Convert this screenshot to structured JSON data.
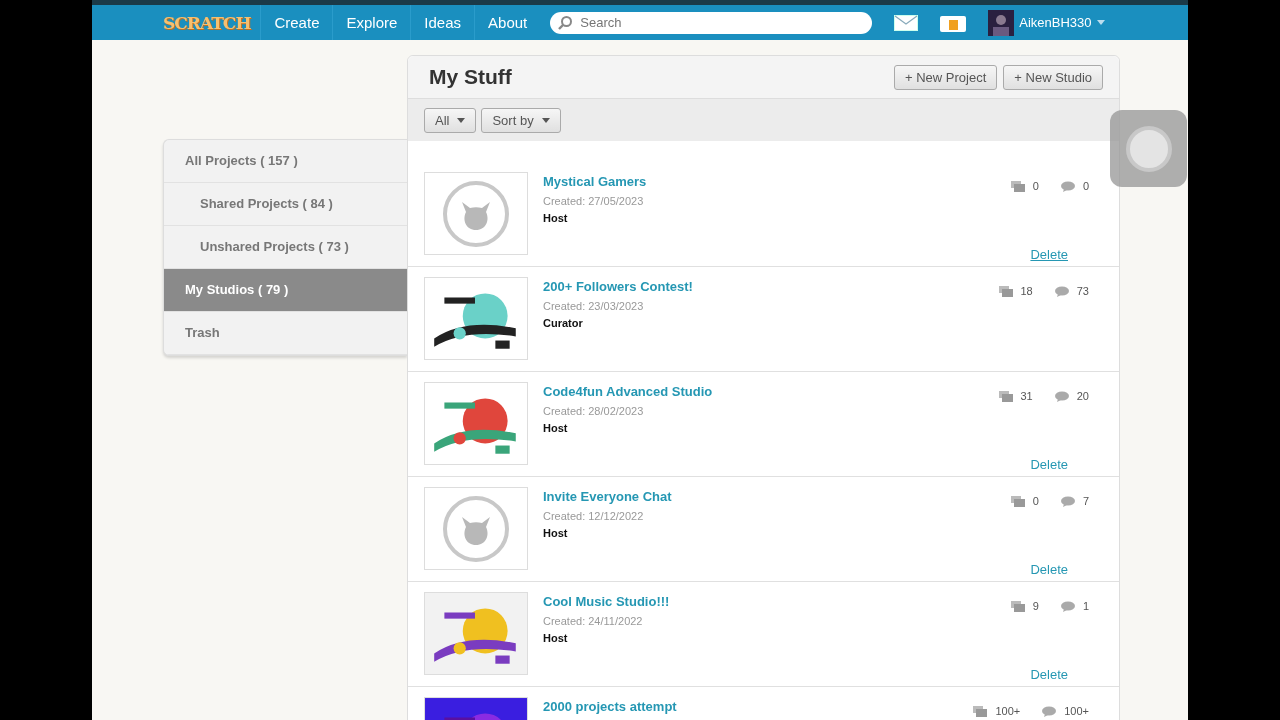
{
  "nav": {
    "logo": "SCRATCH",
    "links": [
      "Create",
      "Explore",
      "Ideas",
      "About"
    ],
    "search": {
      "placeholder": "Search"
    },
    "username": "AikenBH330"
  },
  "sidebar": {
    "items": [
      {
        "label": "All Projects ( 157 )",
        "selected": false,
        "children": [
          {
            "label": "Shared Projects ( 84 )",
            "selected": false
          },
          {
            "label": "Unshared Projects ( 73 )",
            "selected": false
          }
        ]
      },
      {
        "label": "My Studios ( 79 )",
        "selected": true
      },
      {
        "label": "Trash",
        "selected": false
      }
    ]
  },
  "panel": {
    "title": "My Stuff",
    "buttons": [
      "+ New Project",
      "+ New Studio"
    ],
    "filters": [
      "All",
      "Sort by"
    ],
    "rows": [
      {
        "title": "Mystical Gamers",
        "created": "Created: 27/05/2023",
        "role": "Host",
        "projects": "0",
        "comments": "0",
        "kind": "placeholder",
        "delete": "Delete",
        "hovered": true
      },
      {
        "title": "200+ Followers Contest!",
        "created": "Created: 23/03/2023",
        "role": "Curator",
        "projects": "18",
        "comments": "73",
        "kind": "picture"
      },
      {
        "title": "Code4fun Advanced Studio",
        "created": "Created: 28/02/2023",
        "role": "Host",
        "projects": "31",
        "comments": "20",
        "kind": "picture",
        "delete": "Delete",
        "hovered": false
      },
      {
        "title": "Invite Everyone Chat",
        "created": "Created: 12/12/2022",
        "role": "Host",
        "projects": "0",
        "comments": "7",
        "kind": "placeholder",
        "delete": "Delete",
        "hovered": false
      },
      {
        "title": "Cool Music Studio!!!",
        "created": "Created: 24/11/2022",
        "role": "Host",
        "projects": "9",
        "comments": "1",
        "kind": "picture",
        "delete": "Delete",
        "hovered": false
      },
      {
        "title": "2000 projects attempt",
        "projects": "100+",
        "comments": "100+",
        "kind": "picture"
      }
    ]
  }
}
